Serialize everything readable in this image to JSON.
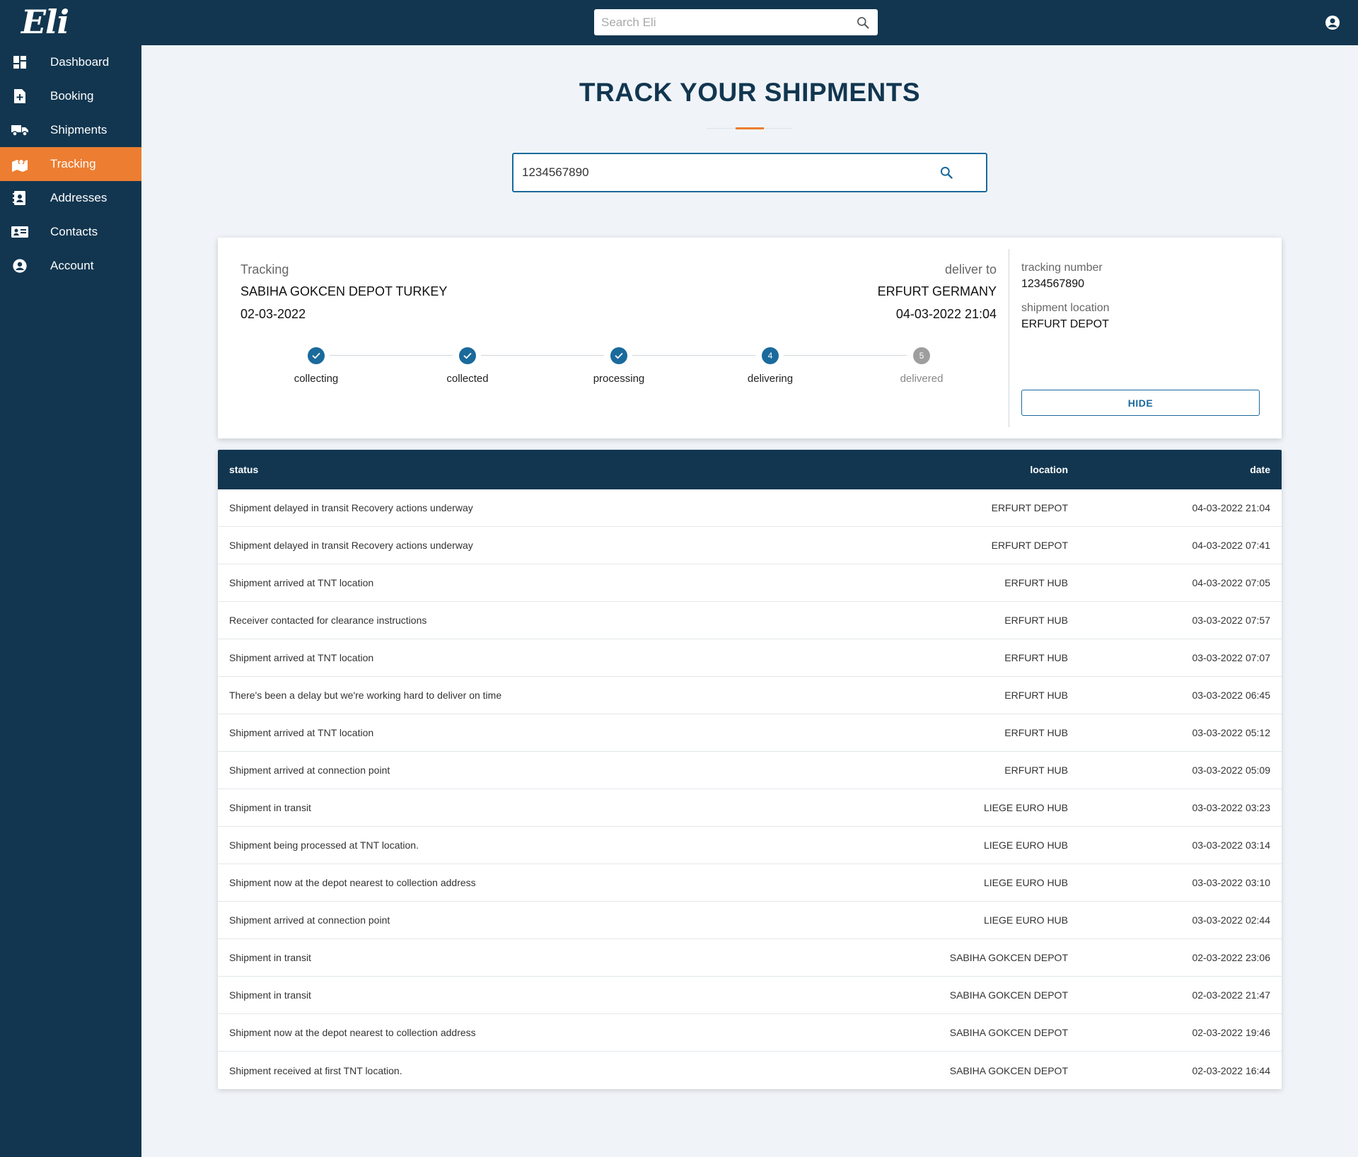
{
  "app": {
    "logo_text": "Eli",
    "search_placeholder": "Search Eli"
  },
  "sidebar": {
    "items": [
      {
        "label": "Dashboard",
        "icon": "dashboard-icon"
      },
      {
        "label": "Booking",
        "icon": "note-add-icon"
      },
      {
        "label": "Shipments",
        "icon": "truck-icon"
      },
      {
        "label": "Tracking",
        "icon": "map-marker-icon",
        "active": true
      },
      {
        "label": "Addresses",
        "icon": "address-book-icon"
      },
      {
        "label": "Contacts",
        "icon": "contact-card-icon"
      },
      {
        "label": "Account",
        "icon": "account-circle-icon"
      }
    ]
  },
  "page": {
    "title": "TRACK YOUR SHIPMENTS",
    "tracking_input_value": "1234567890"
  },
  "card": {
    "from_label": "Tracking",
    "from_place": "SABIHA GOKCEN DEPOT TURKEY",
    "from_date": "02-03-2022",
    "to_label": "deliver to",
    "to_place": "ERFURT GERMANY",
    "to_date": "04-03-2022 21:04",
    "steps": [
      {
        "label": "collecting",
        "state": "done",
        "num": "1"
      },
      {
        "label": "collected",
        "state": "done",
        "num": "2"
      },
      {
        "label": "processing",
        "state": "done",
        "num": "3"
      },
      {
        "label": "delivering",
        "state": "current",
        "num": "4"
      },
      {
        "label": "delivered",
        "state": "pending",
        "num": "5"
      }
    ],
    "tracking_number_label": "tracking number",
    "tracking_number": "1234567890",
    "shipment_location_label": "shipment location",
    "shipment_location": "ERFURT DEPOT",
    "hide_label": "HIDE"
  },
  "table": {
    "headers": {
      "status": "status",
      "location": "location",
      "date": "date"
    },
    "rows": [
      {
        "status": "Shipment delayed in transit Recovery actions underway",
        "location": "ERFURT DEPOT",
        "date": "04-03-2022 21:04"
      },
      {
        "status": "Shipment delayed in transit Recovery actions underway",
        "location": "ERFURT DEPOT",
        "date": "04-03-2022 07:41"
      },
      {
        "status": "Shipment arrived at TNT location",
        "location": "ERFURT HUB",
        "date": "04-03-2022 07:05"
      },
      {
        "status": "Receiver contacted for clearance instructions",
        "location": "ERFURT HUB",
        "date": "03-03-2022 07:57"
      },
      {
        "status": "Shipment arrived at TNT location",
        "location": "ERFURT HUB",
        "date": "03-03-2022 07:07"
      },
      {
        "status": "There's been a delay but we're working hard to deliver on time",
        "location": "ERFURT HUB",
        "date": "03-03-2022 06:45"
      },
      {
        "status": "Shipment arrived at TNT location",
        "location": "ERFURT HUB",
        "date": "03-03-2022 05:12"
      },
      {
        "status": "Shipment arrived at connection point",
        "location": "ERFURT HUB",
        "date": "03-03-2022 05:09"
      },
      {
        "status": "Shipment in transit",
        "location": "LIEGE EURO HUB",
        "date": "03-03-2022 03:23"
      },
      {
        "status": "Shipment being processed at TNT location.",
        "location": "LIEGE EURO HUB",
        "date": "03-03-2022 03:14"
      },
      {
        "status": "Shipment now at the depot nearest to collection address",
        "location": "LIEGE EURO HUB",
        "date": "03-03-2022 03:10"
      },
      {
        "status": "Shipment arrived at connection point",
        "location": "LIEGE EURO HUB",
        "date": "03-03-2022 02:44"
      },
      {
        "status": "Shipment in transit",
        "location": "SABIHA GOKCEN DEPOT",
        "date": "02-03-2022 23:06"
      },
      {
        "status": "Shipment in transit",
        "location": "SABIHA GOKCEN DEPOT",
        "date": "02-03-2022 21:47"
      },
      {
        "status": "Shipment now at the depot nearest to collection address",
        "location": "SABIHA GOKCEN DEPOT",
        "date": "02-03-2022 19:46"
      },
      {
        "status": "Shipment received at first TNT location.",
        "location": "SABIHA GOKCEN DEPOT",
        "date": "02-03-2022 16:44"
      }
    ]
  },
  "colors": {
    "navy": "#123650",
    "accent_orange": "#ed7d31",
    "primary_blue": "#1a6a9c",
    "background": "#f0f4f8"
  }
}
